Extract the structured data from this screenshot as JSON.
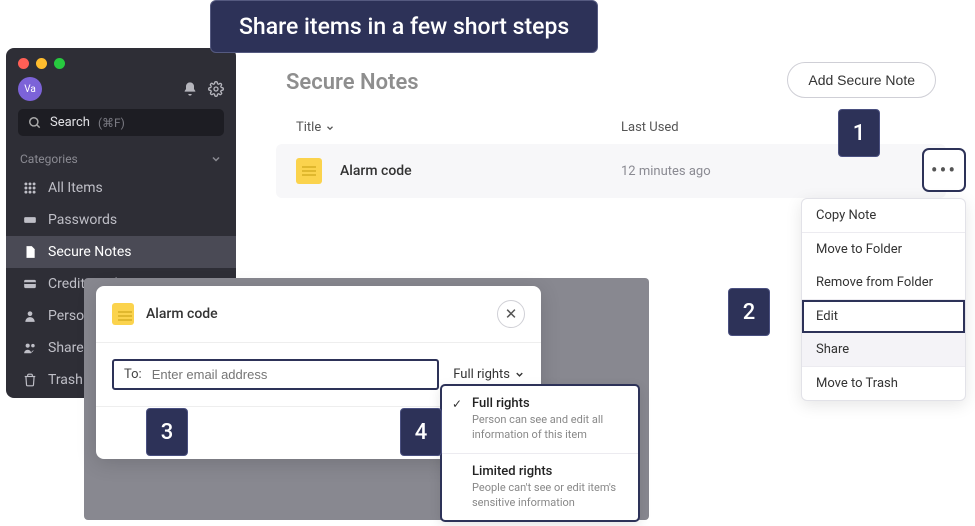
{
  "banner": {
    "title": "Share items in a few short steps"
  },
  "sidebar": {
    "avatar_initials": "Va",
    "search_label": "Search",
    "search_hint": "(⌘F)",
    "categories_label": "Categories",
    "items": [
      {
        "label": "All Items"
      },
      {
        "label": "Passwords"
      },
      {
        "label": "Secure Notes"
      },
      {
        "label": "Credit Cards"
      },
      {
        "label": "Perso"
      },
      {
        "label": "Share"
      },
      {
        "label": "Trash"
      }
    ]
  },
  "main": {
    "page_title": "Secure Notes",
    "add_button": "Add Secure Note",
    "col_title": "Title",
    "col_lastused": "Last Used",
    "row": {
      "title": "Alarm code",
      "time": "12 minutes ago"
    }
  },
  "context_menu": {
    "copy": "Copy Note",
    "move_to": "Move to Folder",
    "remove_from": "Remove from Folder",
    "edit": "Edit",
    "share": "Share",
    "trash": "Move to Trash"
  },
  "dialog": {
    "title": "Alarm code",
    "to_label": "To:",
    "to_placeholder": "Enter email address",
    "rights_label": "Full rights"
  },
  "rights_options": {
    "full_title": "Full rights",
    "full_desc": "Person can see and edit all information of this item",
    "limited_title": "Limited rights",
    "limited_desc": "People can't see or edit item's sensitive information"
  },
  "steps": {
    "s1": "1",
    "s2": "2",
    "s3": "3",
    "s4": "4"
  }
}
